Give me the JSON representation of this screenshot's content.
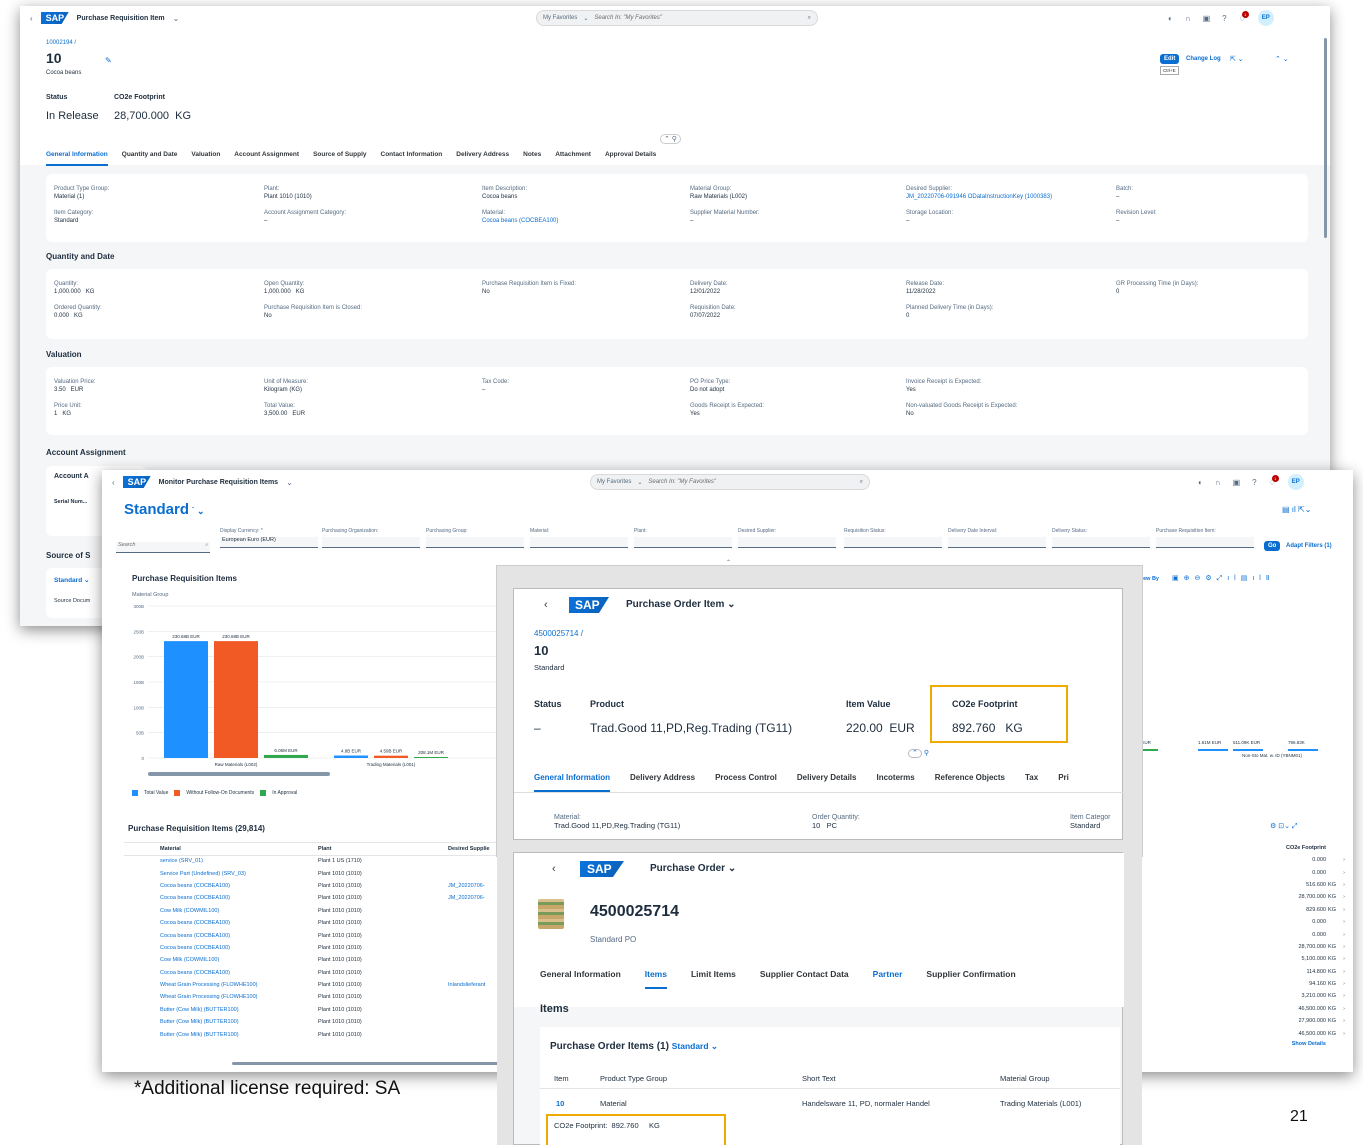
{
  "slide_number": "21",
  "footnote": "*Additional license required: SA",
  "colors": {
    "accent": "#0a6ed1",
    "highlight": "#f0ab00",
    "bar_blue": "#1e90ff",
    "bar_orange": "#f15a24",
    "bar_green": "#2fa84f"
  },
  "win1": {
    "app_title": "Purchase Requisition Item",
    "fav": "My Favorites",
    "search_ph": "Search In: \"My Favorites\"",
    "avatar": "EP",
    "badge": "1",
    "breadcrumb": "10002194 /",
    "item_no": "10",
    "item_desc": "Cocoa beans",
    "edit": "Edit",
    "edit_hint": "Ctrl+E",
    "changelog": "Change Log",
    "status_lbl": "Status",
    "status_val": "In Release",
    "co2_lbl": "CO2e Footprint",
    "co2_val": "28,700.000  KG",
    "tabs": [
      "General Information",
      "Quantity and Date",
      "Valuation",
      "Account Assignment",
      "Source of Supply",
      "Contact Information",
      "Delivery Address",
      "Notes",
      "Attachment",
      "Approval Details"
    ],
    "gen": [
      {
        "l": "Product Type Group:",
        "v": "Material (1)"
      },
      {
        "l": "Plant:",
        "v": "Plant 1010 (1010)"
      },
      {
        "l": "Item Description:",
        "v": "Cocoa beans"
      },
      {
        "l": "Material Group:",
        "v": "Raw Materials (L002)"
      },
      {
        "l": "Desired Supplier:",
        "v": "JM_20220706-091946 ODataInstructionKey (1000383)"
      },
      {
        "l": "Batch:",
        "v": "–"
      },
      {
        "l": "Item Category:",
        "v": "Standard"
      },
      {
        "l": "Account Assignment Category:",
        "v": "–"
      },
      {
        "l": "Material:",
        "v": "Cocoa beans (COCBEA100)"
      },
      {
        "l": "Supplier Material Number:",
        "v": "–"
      },
      {
        "l": "Storage Location:",
        "v": "–"
      },
      {
        "l": "Revision Level:",
        "v": "–"
      }
    ],
    "qd_title": "Quantity and Date",
    "qd": [
      {
        "l": "Quantity:",
        "v": "1,000.000   KG"
      },
      {
        "l": "Open Quantity:",
        "v": "1,000.000   KG"
      },
      {
        "l": "Purchase Requisition Item is Fixed:",
        "v": "No"
      },
      {
        "l": "Delivery Date:",
        "v": "12/01/2022"
      },
      {
        "l": "Release Date:",
        "v": "11/28/2022"
      },
      {
        "l": "GR Processing Time (in Days):",
        "v": "0"
      },
      {
        "l": "Ordered Quantity:",
        "v": "0.000   KG"
      },
      {
        "l": "Purchase Requisition Item is Closed:",
        "v": "No"
      },
      {
        "l": "",
        "v": ""
      },
      {
        "l": "Requisition Date:",
        "v": "07/07/2022"
      },
      {
        "l": "Planned Delivery Time (in Days):",
        "v": "0"
      },
      {
        "l": "",
        "v": ""
      }
    ],
    "val_title": "Valuation",
    "val": [
      {
        "l": "Valuation Price:",
        "v": "3.50   EUR"
      },
      {
        "l": "Unit of Measure:",
        "v": "Kilogram (KG)"
      },
      {
        "l": "Tax Code:",
        "v": "–"
      },
      {
        "l": "PO Price Type:",
        "v": "Do not adopt"
      },
      {
        "l": "Invoice Receipt is Expected:",
        "v": "Yes"
      },
      {
        "l": "",
        "v": ""
      },
      {
        "l": "Price Unit:",
        "v": "1   KG"
      },
      {
        "l": "Total Value:",
        "v": "3,500.00   EUR"
      },
      {
        "l": "",
        "v": ""
      },
      {
        "l": "Goods Receipt is Expected:",
        "v": "Yes"
      },
      {
        "l": "Non-valuated Goods Receipt is Expected:",
        "v": "No"
      },
      {
        "l": "",
        "v": ""
      }
    ],
    "aa_title": "Account Assignment",
    "aa_sub": "Account A",
    "serial": "Serial Num...",
    "sos_title": "Source of S",
    "sos_std": "Standard",
    "sos_doc": "Source Docum"
  },
  "win2": {
    "app_title": "Monitor Purchase Requisition Items",
    "fav": "My Favorites",
    "search_ph": "Search In: \"My Favorites\"",
    "avatar": "EP",
    "variant": "Standard",
    "search": "Search",
    "filters": [
      {
        "l": "Display Currency: *",
        "v": "European Euro (EUR)"
      },
      {
        "l": "Purchasing Organization:",
        "v": ""
      },
      {
        "l": "Purchasing Group:",
        "v": ""
      },
      {
        "l": "Material:",
        "v": ""
      },
      {
        "l": "Plant:",
        "v": ""
      },
      {
        "l": "Desired Supplier:",
        "v": ""
      },
      {
        "l": "Requisition Status:",
        "v": ""
      },
      {
        "l": "Delivery Date Interval:",
        "v": ""
      },
      {
        "l": "Delivery Status:",
        "v": ""
      },
      {
        "l": "Purchase Requisition Item:",
        "v": ""
      }
    ],
    "go": "Go",
    "adapt": "Adapt Filters (1)",
    "chart_title": "Purchase Requisition Items",
    "chart_sub": "Material Group",
    "view_by": "View By",
    "legend": [
      "Total Value",
      "Without Follow-On Documents",
      "In Approval"
    ],
    "table_title": "Purchase Requisition Items (29,814)",
    "cols": [
      "Material",
      "Plant",
      "Desired Supplie"
    ],
    "rows": [
      [
        "service (SRV_01)",
        "Plant 1 US (1710)",
        ""
      ],
      [
        "Service Part (Undefined) (SRV_03)",
        "Plant 1010 (1010)",
        ""
      ],
      [
        "Cocoa beans (COCBEA100)",
        "Plant 1010 (1010)",
        "JM_20220706-"
      ],
      [
        "Cocoa beans (COCBEA100)",
        "Plant 1010 (1010)",
        "JM_20220706-"
      ],
      [
        "Cow Milk (COWMIL100)",
        "Plant 1010 (1010)",
        ""
      ],
      [
        "Cocoa beans (COCBEA100)",
        "Plant 1010 (1010)",
        ""
      ],
      [
        "Cocoa beans (COCBEA100)",
        "Plant 1010 (1010)",
        ""
      ],
      [
        "Cocoa beans (COCBEA100)",
        "Plant 1010 (1010)",
        ""
      ],
      [
        "Cow Milk (COWMIL100)",
        "Plant 1010 (1010)",
        ""
      ],
      [
        "Cocoa beans (COCBEA100)",
        "Plant 1010 (1010)",
        ""
      ],
      [
        "Wheat Grain Processing (FLOWHE100)",
        "Plant 1010 (1010)",
        "Inlandslieferant"
      ],
      [
        "Wheat Grain Processing (FLOWHE100)",
        "Plant 1010 (1010)",
        ""
      ],
      [
        "Butter (Cow Milk) (BUTTER100)",
        "Plant 1010 (1010)",
        ""
      ],
      [
        "Butter (Cow Milk) (BUTTER100)",
        "Plant 1010 (1010)",
        ""
      ],
      [
        "Butter (Cow Milk) (BUTTER100)",
        "Plant 1010 (1010)",
        ""
      ]
    ],
    "co2_col": "CO2e Footprint",
    "co2_rows": [
      [
        "0.000",
        ""
      ],
      [
        "0.000",
        ""
      ],
      [
        "516.600",
        "KG"
      ],
      [
        "28,700.000",
        "KG"
      ],
      [
        "829.600",
        "KG"
      ],
      [
        "0.000",
        ""
      ],
      [
        "0.000",
        ""
      ],
      [
        "28,700.000",
        "KG"
      ],
      [
        "5,100.000",
        "KG"
      ],
      [
        "114.800",
        "KG"
      ],
      [
        "94.160",
        "KG"
      ],
      [
        "3,210.000",
        "KG"
      ],
      [
        "46,500.000",
        "KG"
      ],
      [
        "27,900.000",
        "KG"
      ],
      [
        "46,500.000",
        "KG"
      ]
    ],
    "show_details": "Show Details",
    "right_labels": [
      "11.2M EUR",
      "1.61M EUR",
      "511.09K EUR",
      "796.83K"
    ],
    "right_cat": "Non-Sto Mat. w. ID (YBNM01)"
  },
  "chart_data": {
    "type": "bar",
    "title": "Purchase Requisition Items",
    "xlabel": "Material Group",
    "ylim": [
      0,
      300000000000
    ],
    "yticks": [
      "300B",
      "250B",
      "200B",
      "150B",
      "100B",
      "50B",
      "0"
    ],
    "categories": [
      "Raw Materials (L002)",
      "Trading Materials (L001)"
    ],
    "series": [
      {
        "name": "Total Value",
        "color": "#1e90ff",
        "values": [
          230680000000,
          4880000000
        ],
        "labels": [
          "230.68B EUR",
          "4.8B EUR"
        ]
      },
      {
        "name": "Without Follow-On Documents",
        "color": "#f15a24",
        "values": [
          230680000000,
          4590000000
        ],
        "labels": [
          "230.68B EUR",
          "4.59B EUR"
        ]
      },
      {
        "name": "In Approval",
        "color": "#2fa84f",
        "values": [
          6060000000,
          208100000
        ],
        "labels": [
          "6.06M EUR",
          "208.1M EUR"
        ]
      }
    ]
  },
  "win3": {
    "app_title": "Purchase Order Item",
    "breadcrumb": "4500025714 /",
    "item_no": "10",
    "item_type": "Standard",
    "hdr": [
      "Status",
      "Product",
      "Item Value",
      "CO2e Footprint"
    ],
    "status": "–",
    "product": "Trad.Good 11,PD,Reg.Trading (TG11)",
    "item_value": "220.00  EUR",
    "co2": "892.760   KG",
    "tabs": [
      "General Information",
      "Delivery Address",
      "Process Control",
      "Delivery Details",
      "Incoterms",
      "Reference Objects",
      "Tax",
      "Pri"
    ],
    "fields": [
      {
        "l": "Material:",
        "v": "Trad.Good 11,PD,Reg.Trading (TG11)"
      },
      {
        "l": "Order Quantity:",
        "v": "10   PC"
      },
      {
        "l": "Item Categor",
        "v": "Standard"
      }
    ]
  },
  "win4": {
    "app_title": "Purchase Order",
    "po_no": "4500025714",
    "po_type": "Standard PO",
    "tabs": [
      "General Information",
      "Items",
      "Limit Items",
      "Supplier Contact Data",
      "Partner",
      "Supplier Confirmation"
    ],
    "items_title": "Items",
    "table_title": "Purchase Order Items (1)",
    "variant": "Standard",
    "cols": [
      "Item",
      "Product Type Group",
      "Short Text",
      "Material Group"
    ],
    "row": [
      "10",
      "Material",
      "Handelsware 11, PD, normaler Handel",
      "Trading Materials (L001)"
    ],
    "co2_line": "CO2e Footprint:  892.760     KG"
  }
}
